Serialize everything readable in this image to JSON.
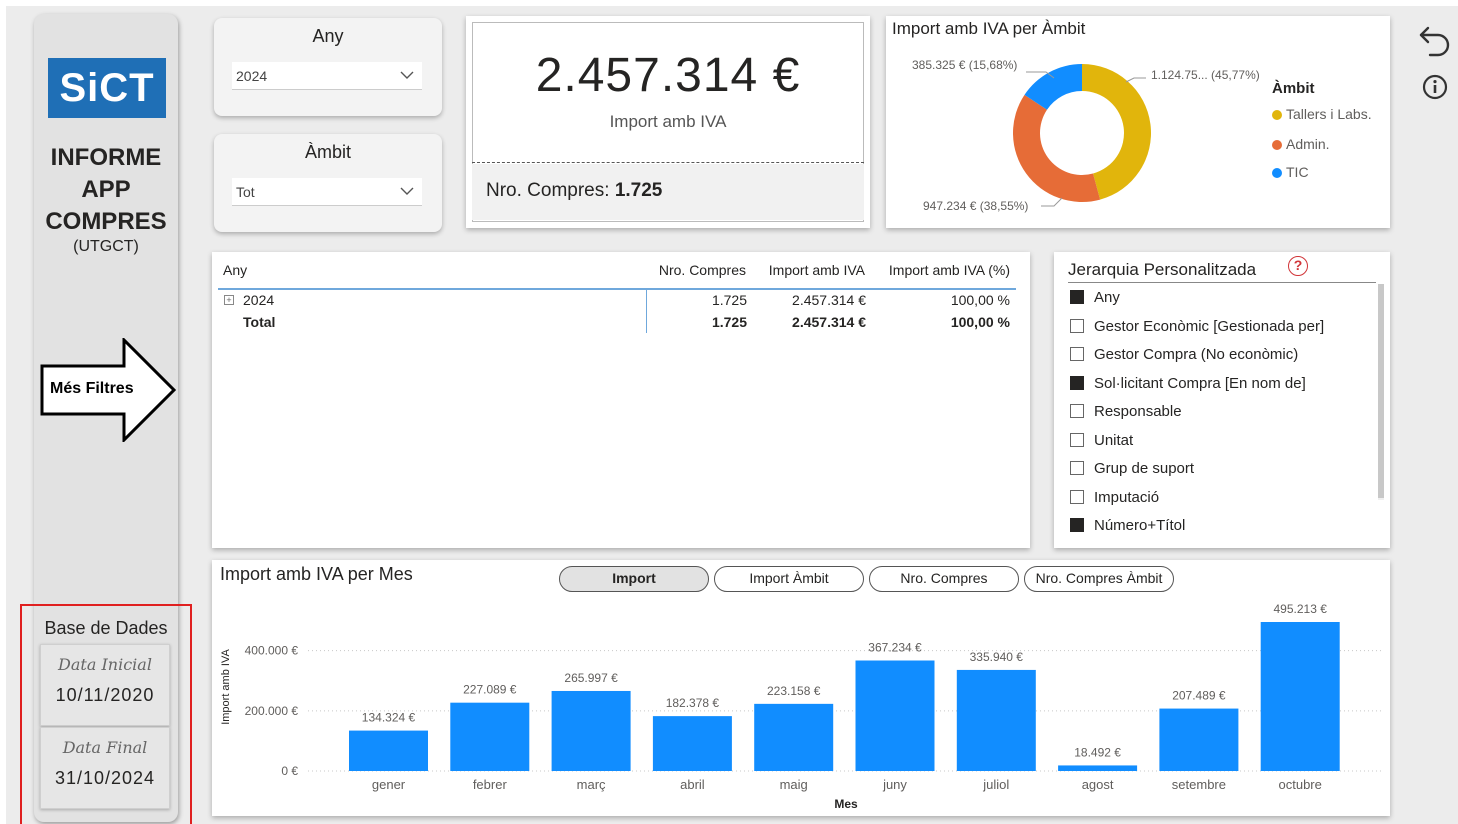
{
  "sidebar": {
    "logo_text": "SiCT",
    "title_lines": [
      "INFORME",
      "APP",
      "COMPRES"
    ],
    "subtitle": "(UTGCT)",
    "more_filters_label": "Més Filtres",
    "database_title": "Base de Dades",
    "start_date_label": "Data Inicial",
    "start_date": "10/11/2020",
    "end_date_label": "Data Final",
    "end_date": "31/10/2024"
  },
  "slicers": {
    "year": {
      "title": "Any",
      "value": "2024"
    },
    "scope": {
      "title": "Àmbit",
      "value": "Tot"
    }
  },
  "kpi": {
    "total_import": "2.457.314 €",
    "total_label": "Import amb IVA",
    "purchases_label": "Nro. Compres:",
    "purchases_value": "1.725"
  },
  "donut": {
    "title": "Import amb IVA per Àmbit",
    "legend_title": "Àmbit",
    "labels": {
      "tallers": "1.124.75... (45,77%)",
      "admin": "947.234 € (38,55%)",
      "tic": "385.325 € (15,68%)"
    }
  },
  "table": {
    "headers": [
      "Any",
      "Nro. Compres",
      "Import amb IVA",
      "Import amb IVA (%)"
    ],
    "rows": [
      {
        "label": "2024",
        "compres": "1.725",
        "import": "2.457.314 €",
        "pct": "100,00 %"
      }
    ],
    "total": {
      "label": "Total",
      "compres": "1.725",
      "import": "2.457.314 €",
      "pct": "100,00 %"
    }
  },
  "hierarchy": {
    "title": "Jerarquia Personalitzada",
    "help_glyph": "?",
    "items": [
      {
        "label": "Any",
        "checked": true
      },
      {
        "label": "Gestor Econòmic [Gestionada per]",
        "checked": false
      },
      {
        "label": "Gestor Compra (No econòmic)",
        "checked": false
      },
      {
        "label": "Sol·licitant Compra [En nom de]",
        "checked": true
      },
      {
        "label": "Responsable",
        "checked": false
      },
      {
        "label": "Unitat",
        "checked": false
      },
      {
        "label": "Grup de suport",
        "checked": false
      },
      {
        "label": "Imputació",
        "checked": false
      },
      {
        "label": "Número+Títol",
        "checked": true
      }
    ]
  },
  "bar_panel": {
    "title": "Import amb IVA per Mes",
    "buttons": [
      "Import",
      "Import Àmbit",
      "Nro. Compres",
      "Nro. Compres Àmbit"
    ],
    "active_button": "Import"
  },
  "chart_data": [
    {
      "type": "bar",
      "title": "Import amb IVA per Mes",
      "xlabel": "Mes",
      "ylabel": "Import amb IVA",
      "categories": [
        "gener",
        "febrer",
        "març",
        "abril",
        "maig",
        "juny",
        "juliol",
        "agost",
        "setembre",
        "octubre"
      ],
      "values": [
        134324,
        227089,
        265997,
        182378,
        223158,
        367234,
        335940,
        18492,
        207489,
        495213
      ],
      "data_labels": [
        "134.324 €",
        "227.089 €",
        "265.997 €",
        "182.378 €",
        "223.158 €",
        "367.234 €",
        "335.940 €",
        "18.492 €",
        "207.489 €",
        "495.213 €"
      ],
      "yticks": [
        0,
        200000,
        400000
      ],
      "ytick_labels": [
        "0 €",
        "200.000 €",
        "400.000 €"
      ],
      "ylim": [
        0,
        495213
      ],
      "color": "#118dff",
      "grid": true
    },
    {
      "type": "pie",
      "title": "Import amb IVA per Àmbit",
      "legend_title": "Àmbit",
      "categories": [
        "Tallers i Labs.",
        "Admin.",
        "TIC"
      ],
      "values": [
        1124755,
        947234,
        385325
      ],
      "percent": [
        45.77,
        38.55,
        15.68
      ],
      "colors": [
        "#e1b50c",
        "#e66c37",
        "#118dff"
      ],
      "legend": "right"
    }
  ],
  "colors": {
    "accent_blue": "#118dff",
    "gold": "#e1b50c",
    "orange": "#e66c37",
    "highlight_red": "#e02020"
  }
}
